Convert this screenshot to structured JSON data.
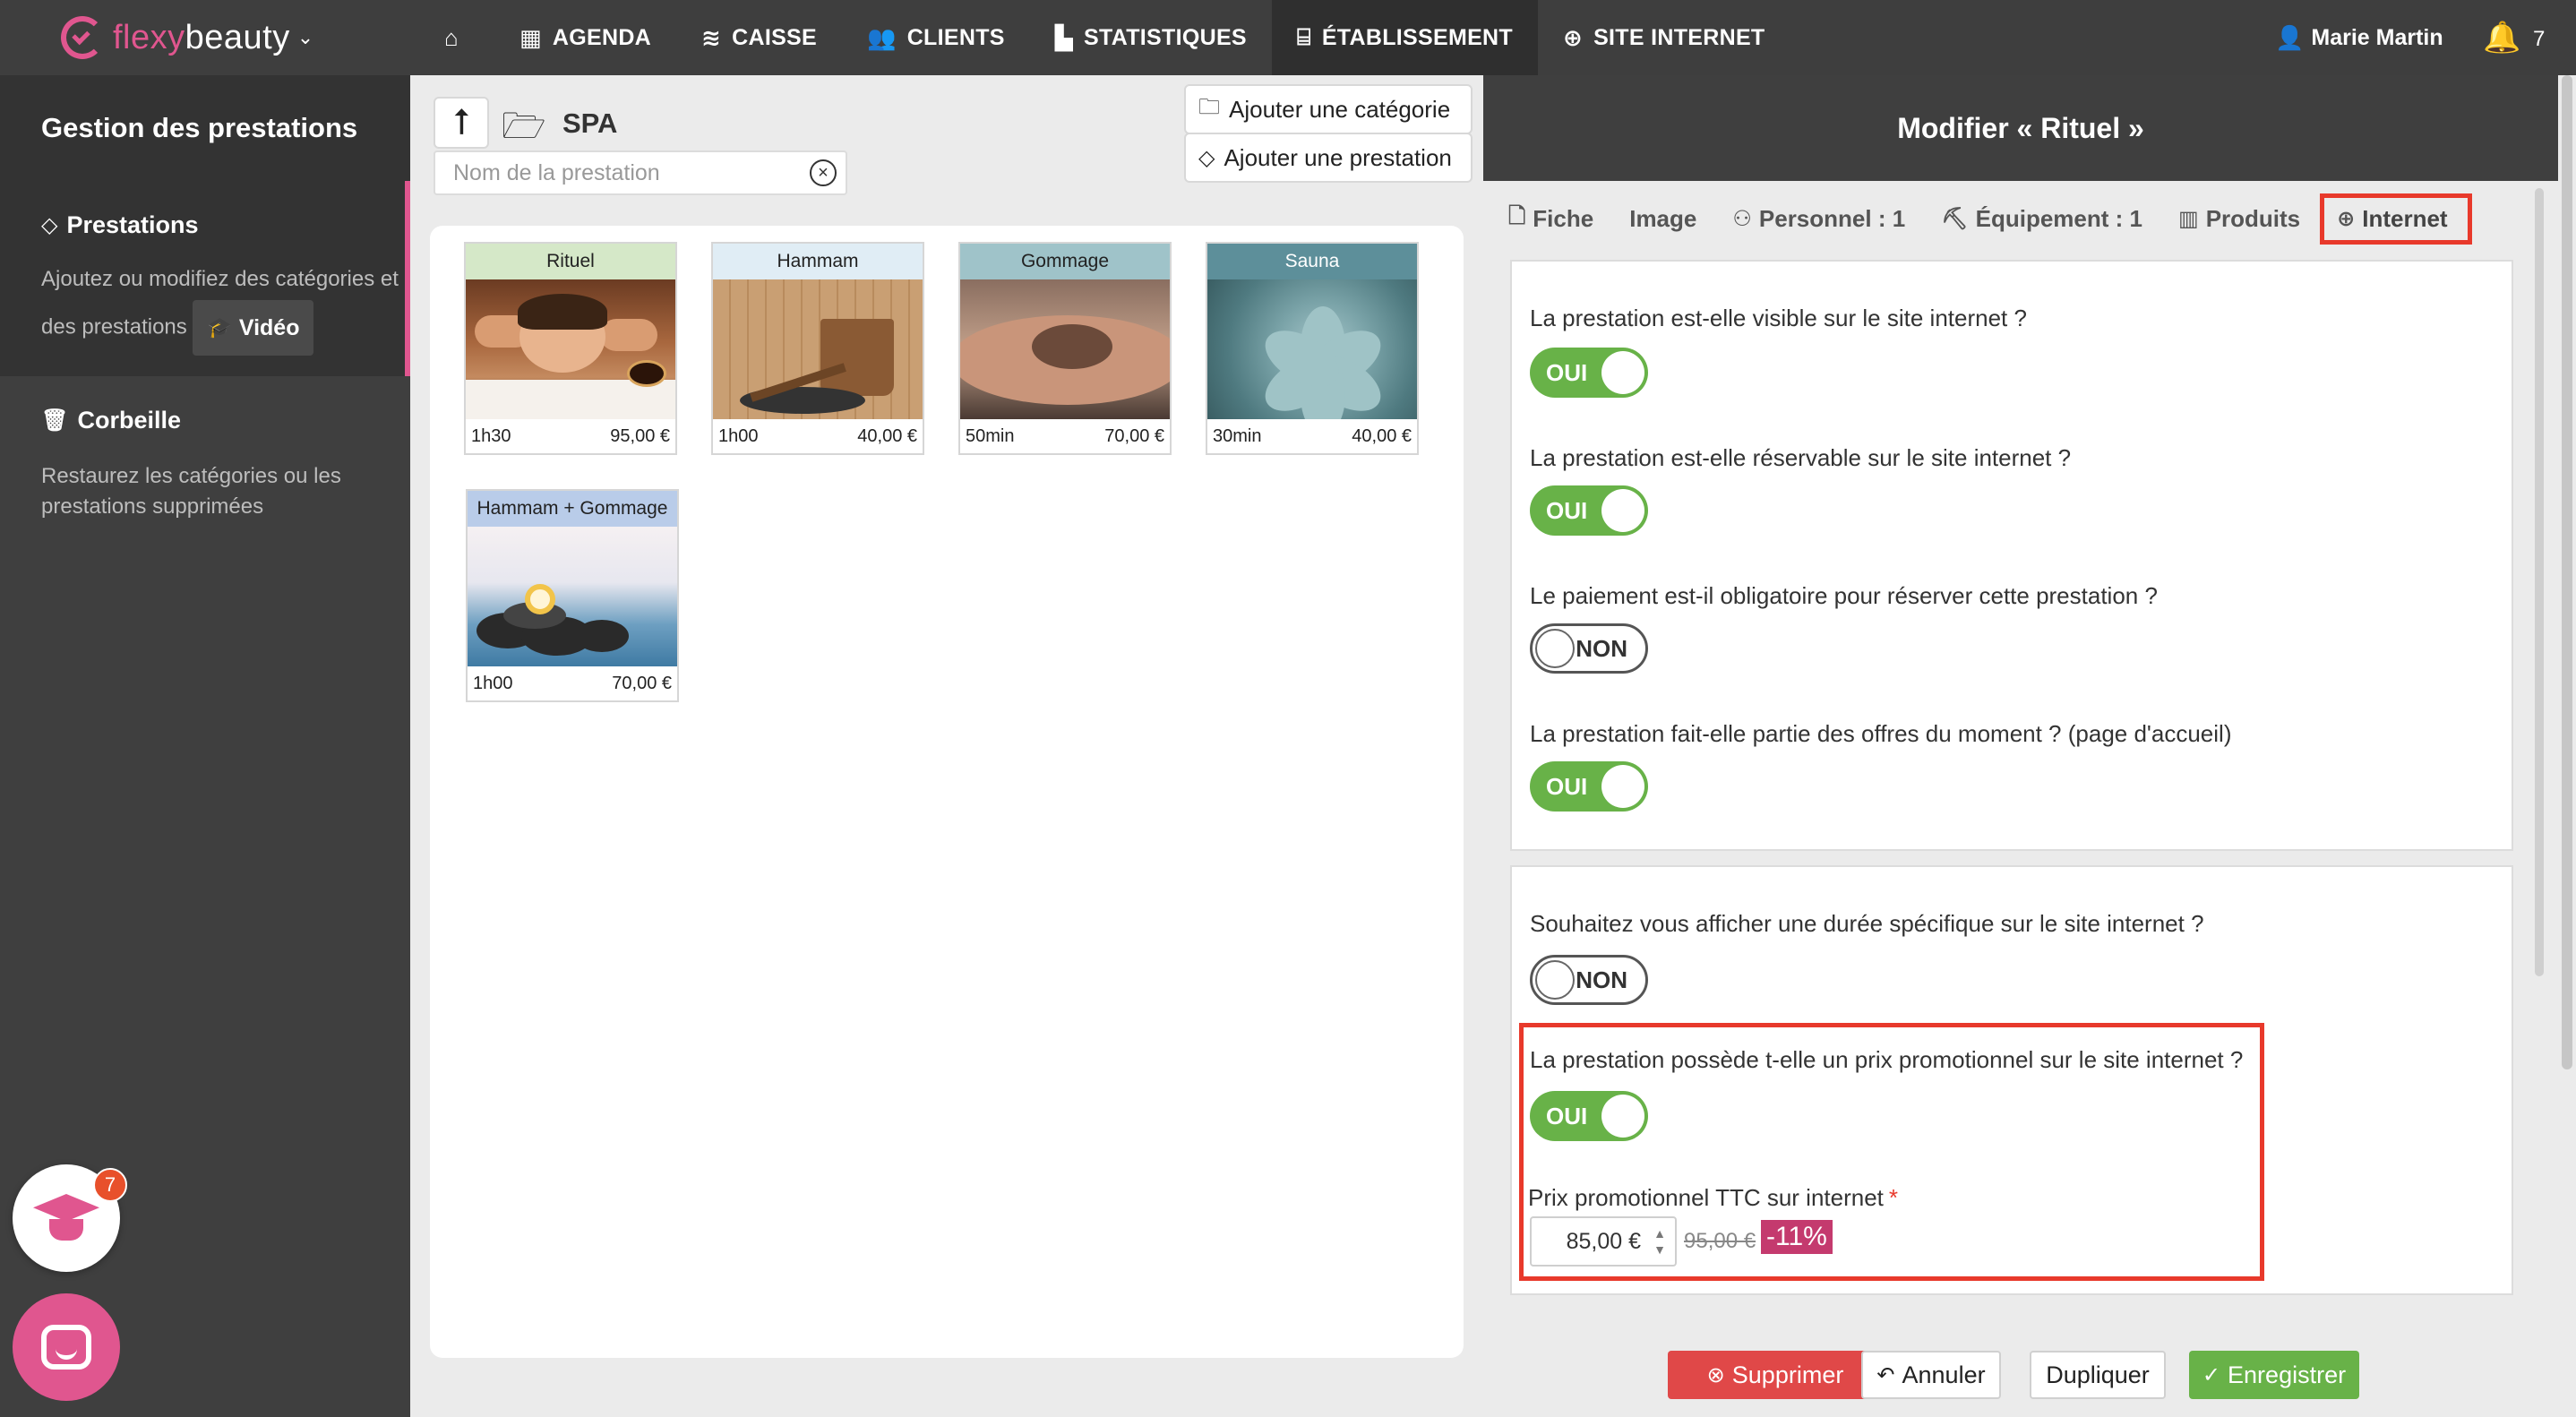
{
  "nav": {
    "logo_part1": "flexy",
    "logo_part2": "beauty",
    "items": [
      {
        "label": "AGENDA",
        "icon": "calendar-icon"
      },
      {
        "label": "CAISSE",
        "icon": "coins-icon"
      },
      {
        "label": "CLIENTS",
        "icon": "users-icon"
      },
      {
        "label": "STATISTIQUES",
        "icon": "chart-icon"
      },
      {
        "label": "ÉTABLISSEMENT",
        "icon": "store-icon"
      },
      {
        "label": "SITE INTERNET",
        "icon": "globe-icon"
      }
    ],
    "active_item": "ÉTABLISSEMENT",
    "user_name": "Marie Martin",
    "notification_count": "7"
  },
  "sidebar": {
    "title": "Gestion des prestations",
    "prestations": {
      "label": "Prestations",
      "description": "Ajoutez ou modifiez des catégories et des prestations",
      "video_label": "Vidéo"
    },
    "corbeille": {
      "label": "Corbeille",
      "description": "Restaurez les catégories ou les prestations supprimées"
    },
    "academy_badge": "7"
  },
  "middle": {
    "folder_name": "SPA",
    "search_placeholder": "Nom de la prestation",
    "add_category_label": "Ajouter une catégorie",
    "add_prestation_label": "Ajouter une prestation",
    "cards": [
      {
        "title": "Rituel",
        "duration": "1h30",
        "price": "95,00 €",
        "header_color": "#d5e8c8"
      },
      {
        "title": "Hammam",
        "duration": "1h00",
        "price": "40,00 €",
        "header_color": "#e0edf5"
      },
      {
        "title": "Gommage",
        "duration": "50min",
        "price": "70,00 €",
        "header_color": "#9fc3c9"
      },
      {
        "title": "Sauna",
        "duration": "30min",
        "price": "40,00 €",
        "header_color": "#5d8f9a"
      },
      {
        "title": "Hammam + Gommage",
        "duration": "1h00",
        "price": "70,00 €",
        "header_color": "#b9cce9"
      }
    ]
  },
  "right": {
    "header_title": "Modifier « Rituel »",
    "tabs": [
      {
        "label": "Fiche",
        "icon": "file-icon"
      },
      {
        "label": "Image",
        "icon": ""
      },
      {
        "label": "Personnel : 1",
        "icon": "people-icon"
      },
      {
        "label": "Équipement : 1",
        "icon": "equipment-icon"
      },
      {
        "label": "Produits",
        "icon": "barcode-icon"
      },
      {
        "label": "Internet",
        "icon": "globe-icon"
      }
    ],
    "active_tab": "Internet",
    "visibility_questions": [
      {
        "text": "La prestation est-elle visible sur le site internet ?",
        "toggle": "OUI"
      },
      {
        "text": "La prestation est-elle réservable sur le site internet ?",
        "toggle": "OUI"
      },
      {
        "text": "Le paiement est-il obligatoire pour réserver cette prestation ?",
        "toggle": "NON"
      },
      {
        "text": "La prestation fait-elle partie des offres du moment ? (page d'accueil)",
        "toggle": "OUI"
      }
    ],
    "option_questions": [
      {
        "text": "Souhaitez vous afficher une durée spécifique sur le site internet ?",
        "toggle": "NON"
      },
      {
        "text": "La prestation possède t-elle un prix promotionnel sur le site internet ?",
        "toggle": "OUI"
      }
    ],
    "promo": {
      "label": "Prix promotionnel TTC sur internet",
      "required_mark": "*",
      "value": "85,00 €",
      "old_price": "95,00 €",
      "discount": "-11%"
    },
    "actions": {
      "delete": "Supprimer",
      "cancel": "Annuler",
      "duplicate": "Dupliquer",
      "save": "Enregistrer"
    }
  }
}
